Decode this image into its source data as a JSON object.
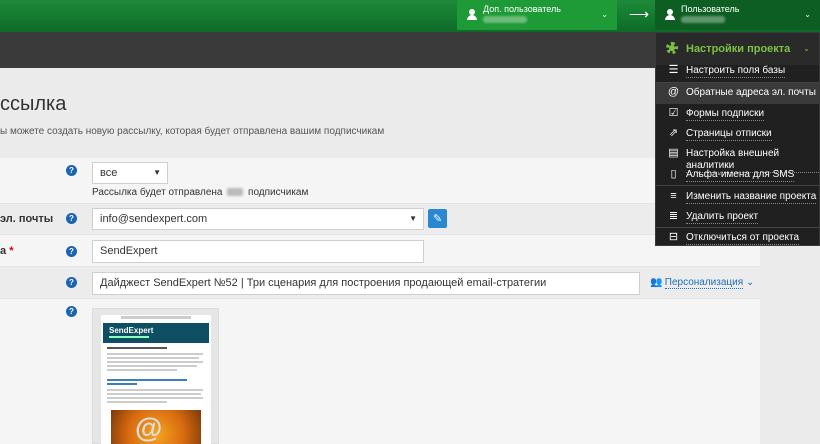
{
  "topbar": {
    "extra_user_label": "Доп. пользователь",
    "main_user_label": "Пользователь",
    "arrow": "⟶"
  },
  "page": {
    "title": "ссылка",
    "subtitle": "ы можете создать новую рассылку, которая будет отправлена вашим подписчикам"
  },
  "form": {
    "rows": [
      {
        "label": "",
        "value": "все",
        "note_prefix": "Рассылка будет отправлена",
        "note_suffix": "подписчикам"
      },
      {
        "label": "эл. почты",
        "value": "info@sendexpert.com"
      },
      {
        "label": "а",
        "value": "SendExpert"
      },
      {
        "label": "",
        "value": "Дайджест SendExpert №52 | Три сценария для построения продающей email-стратегии",
        "action": "Персонализация"
      },
      {
        "label": ""
      }
    ],
    "help_glyph": "?",
    "required_mark": "*"
  },
  "preview": {
    "logo_text": "SendExpert",
    "image_glyph": "@"
  },
  "menu": {
    "header": "Настройки проекта",
    "items": [
      {
        "label": "Настроить поля базы",
        "icon": "list-icon",
        "glyph": "☰"
      },
      {
        "label": "Обратные адреса эл. почты",
        "icon": "at-icon",
        "glyph": "@"
      },
      {
        "label": "Формы подписки",
        "icon": "checkbox-edit-icon",
        "glyph": "☑"
      },
      {
        "label": "Страницы отписки",
        "icon": "external-link-icon",
        "glyph": "⇗"
      },
      {
        "label": "Настройка внешней аналитики",
        "icon": "chart-icon",
        "glyph": "▤"
      },
      {
        "label": "Альфа-имена для SMS",
        "icon": "mobile-icon",
        "glyph": "▯"
      },
      {
        "label": "Изменить название проекта",
        "icon": "stack-icon",
        "glyph": "≡"
      },
      {
        "label": "Удалить проект",
        "icon": "stack-delete-icon",
        "glyph": "≣"
      },
      {
        "label": "Отключиться от проекта",
        "icon": "disconnect-icon",
        "glyph": "⊟"
      }
    ]
  },
  "colors": {
    "brand_green": "#1f8a3a",
    "menu_accent": "#7dc242",
    "link_blue": "#1f6fb6",
    "edit_blue": "#2a88d0"
  }
}
